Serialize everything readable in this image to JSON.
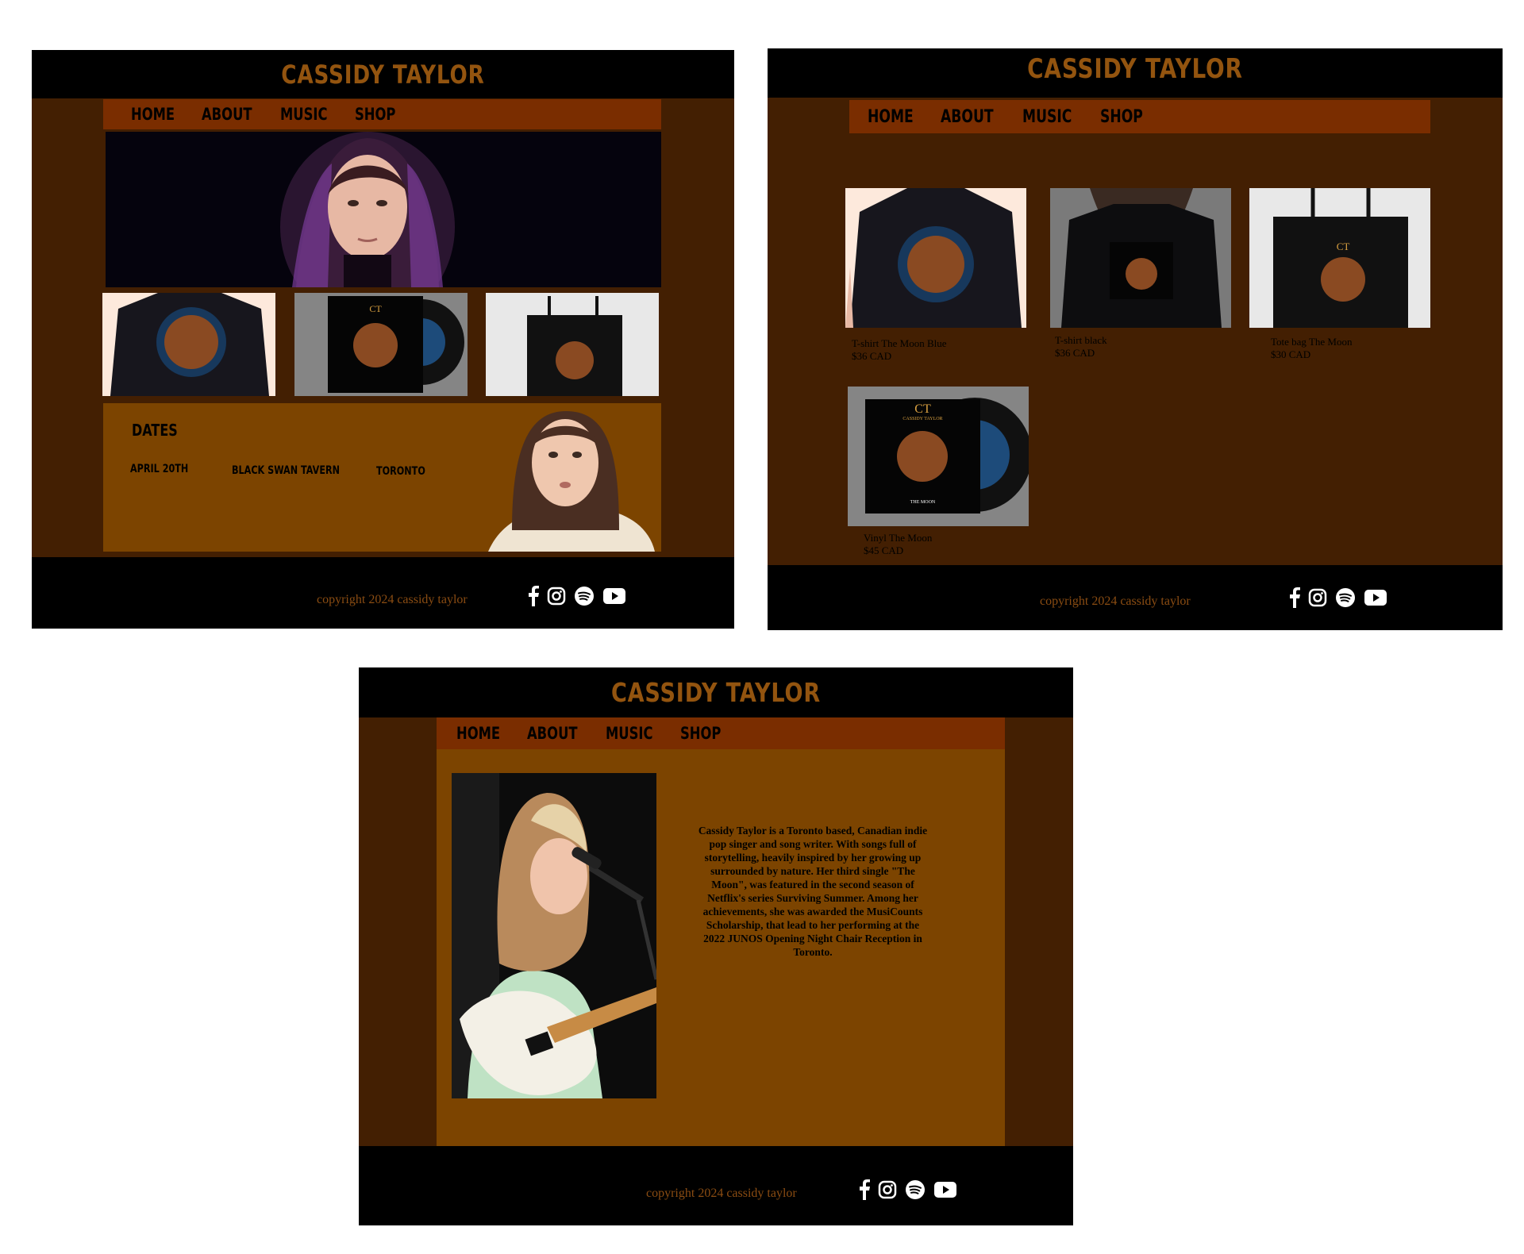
{
  "site": {
    "brand": "CASSIDY TAYLOR",
    "nav": [
      "HOME",
      "ABOUT",
      "MUSIC",
      "SHOP"
    ],
    "footer_copyright": "copyright 2024 cassidy taylor",
    "social_icons": [
      "facebook-icon",
      "instagram-icon",
      "spotify-icon",
      "youtube-icon"
    ]
  },
  "colors": {
    "brand_text": "#93540f",
    "nav_bar": "#7a2d00",
    "page_bg": "#431f02",
    "panel": "#7c4400",
    "header_footer": "#000000"
  },
  "home": {
    "dates_title": "DATES",
    "events": [
      {
        "date": "APRIL 20TH",
        "venue": "BLACK SWAN TAVERN",
        "city": "TORONTO"
      }
    ]
  },
  "shop": {
    "products": [
      {
        "name": "T-shirt The Moon Blue",
        "price": "$36 CAD"
      },
      {
        "name": "T-shirt black",
        "price": "$36 CAD"
      },
      {
        "name": "Tote bag The Moon",
        "price": "$30 CAD"
      },
      {
        "name": "Vinyl The Moon",
        "price": "$45 CAD"
      }
    ],
    "album_logo": "CT",
    "album_artist": "CASSIDY TAYLOR",
    "album_title": "THE MOON"
  },
  "about": {
    "bio": "Cassidy Taylor is a Toronto based, Canadian indie pop singer and song writer. With songs full of storytelling, heavily inspired by her growing up surrounded by nature. Her third single \"The Moon\", was featured in the second season of Netflix's series Surviving Summer. Among her achievements, she was awarded the MusiCounts Scholarship, that lead to her performing at the 2022 JUNOS Opening Night Chair Reception in Toronto."
  }
}
